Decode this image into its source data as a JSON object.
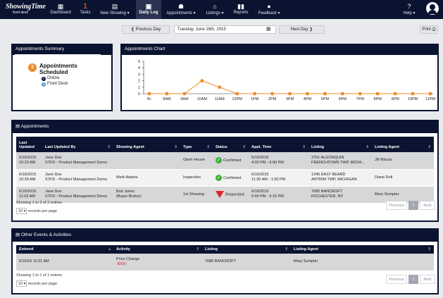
{
  "logo": {
    "line1": "ShowingTime",
    "line2": "front desk"
  },
  "nav": {
    "items": [
      {
        "label": "Dashboard",
        "icon": "grid-icon"
      },
      {
        "label": "Tasks",
        "badge": "1"
      },
      {
        "label": "New Showing ▾",
        "icon": "calendar-icon"
      },
      {
        "label": "Daily Log",
        "icon": "clipboard-icon"
      },
      {
        "label": "Appointments ▾",
        "icon": "people-icon"
      },
      {
        "label": "Listings ▾",
        "icon": "home-icon"
      },
      {
        "label": "Reports",
        "icon": "bar-chart-icon"
      },
      {
        "label": "Feedback ▾",
        "icon": "speech-bubble-icon"
      }
    ],
    "help": "Help ▾"
  },
  "toolbar": {
    "prev": "❮ Previous Day",
    "date": "Tuesday, June 16th, 2015",
    "next": "Next Day ❯",
    "print": "Print"
  },
  "summary": {
    "title": "Appointments Summary",
    "count": "3",
    "label_line1": "Appointments",
    "label_line2": "Scheduled",
    "legend": [
      {
        "count": "0",
        "label": "Online",
        "color": "#0a1330"
      },
      {
        "count": "3",
        "label": "Front Desk",
        "color": "#5a9bd5"
      }
    ]
  },
  "chart_panel": {
    "title": "Appointments Chart"
  },
  "chart_data": {
    "type": "line",
    "categories": [
      "8<",
      "8AM",
      "9AM",
      "10AM",
      "11AM",
      "12PM",
      "1PM",
      "2PM",
      "3PM",
      "4PM",
      "5PM",
      "6PM",
      "7PM",
      "8PM",
      "9PM",
      "10PM",
      "11PM"
    ],
    "values": [
      0,
      0,
      0,
      2,
      1,
      0,
      0,
      0,
      0,
      0,
      0,
      0,
      0,
      0,
      0,
      0,
      0
    ],
    "ylim": [
      0,
      5
    ],
    "yticks": [
      "0",
      "1",
      "2",
      "3",
      "4",
      "5"
    ],
    "color": "#f08a24",
    "grid": false
  },
  "appointments": {
    "title": "Appointments",
    "columns": [
      "Last Updated",
      "Last Updated By",
      "Showing Agent",
      "Type",
      "Status",
      "Appt. Time",
      "Listing",
      "Listing Agent"
    ],
    "rows": [
      {
        "updated": [
          "6/16/2015",
          "10:23 AM"
        ],
        "by": [
          "Jane Doe",
          "STFD - Product Management Demo"
        ],
        "agent": [
          "",
          ""
        ],
        "type": "Open House",
        "status": "Confirmed",
        "status_kind": "ok",
        "time": [
          "6/16/2015",
          "4:00 PM - 6:00 PM"
        ],
        "listing": [
          "3751 ALGONQUIN",
          "FRENCHTOWN TWP, MICHI..."
        ],
        "listing_agent": "Jill Mazza"
      },
      {
        "updated": [
          "6/16/2015",
          "10:39 AM"
        ],
        "by": [
          "Jane Doe",
          "STFD - Product Management Demo"
        ],
        "agent": [
          "Mark Adams",
          ""
        ],
        "type": "Inspection",
        "status": "Confirmed",
        "status_kind": "ok",
        "time": [
          "6/16/2015",
          "11:30 AM - 1:30 PM"
        ],
        "listing": [
          "1346 EAST BEARD",
          "ANTRIM TWP, MICHIGAN"
        ],
        "listing_agent": "Diane Roll"
      },
      {
        "updated": [
          "6/16/2015",
          "11:03 AM"
        ],
        "by": [
          "Jane Doe",
          "STFD - Product Management Demo"
        ],
        "agent": [
          "Bob Jones",
          "(Buyer Broker)"
        ],
        "type": "1st Showing",
        "status": "Requested",
        "status_kind": "req",
        "time": [
          "6/16/2015",
          "5:00 PM - 5:15 PM"
        ],
        "listing": [
          "7685 BANCROFT",
          "ROCHESTER, NY"
        ],
        "listing_agent": "Mary Sumpter"
      }
    ],
    "showing": "Showing 1 to 3 of 3 entries",
    "page_size": "10",
    "records_per_page": "records per page",
    "prev": "Previous",
    "page": "1",
    "next": "Next"
  },
  "events": {
    "title": "Other Events & Activities",
    "columns": [
      "Entered",
      "Activity",
      "Listing",
      "Listing Agent"
    ],
    "rows": [
      {
        "entered": "6/16/15 11:01 AM",
        "activity": "Price Change",
        "change": "-$900",
        "listing": "7685 BANCROFT",
        "agent": "Mary Sumpter"
      }
    ],
    "showing": "Showing 1 to 1 of 1 entries",
    "page_size": "10",
    "records_per_page": "records per page",
    "prev": "Previous",
    "page": "1",
    "next": "Next"
  }
}
